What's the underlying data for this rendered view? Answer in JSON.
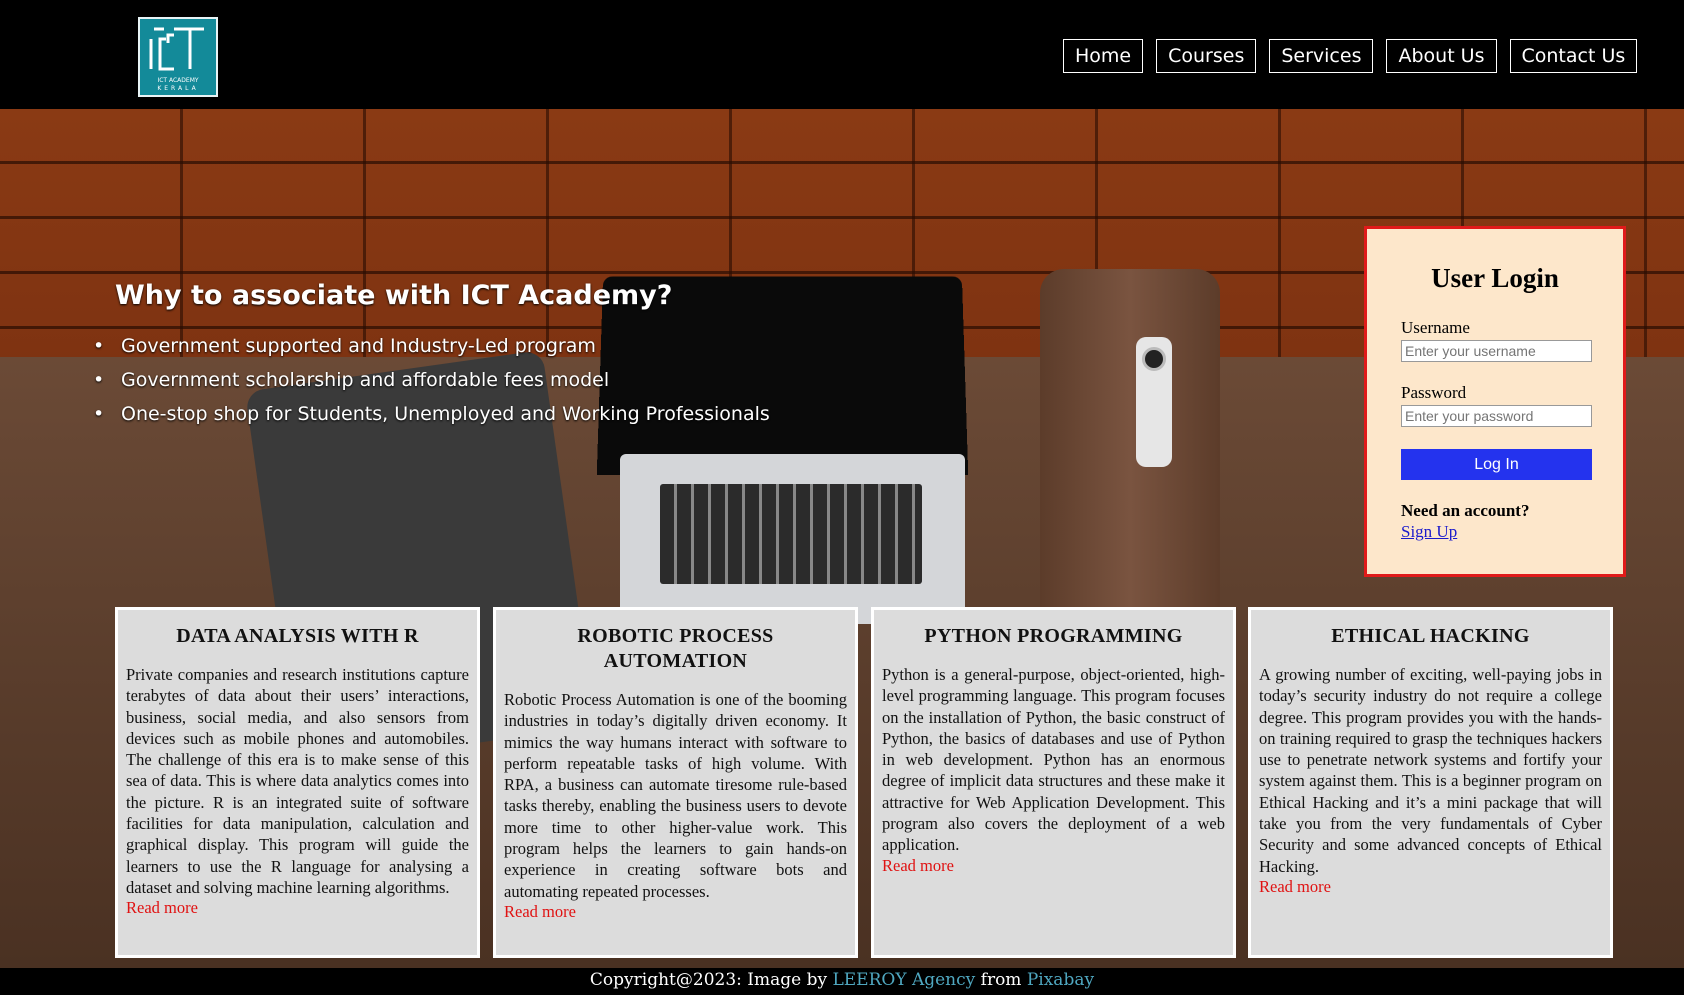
{
  "brand": {
    "logo_text_line1": "ICT ACADEMY",
    "logo_text_line2": "KERALA",
    "logo_color": "#138a99"
  },
  "nav": {
    "items": [
      "Home",
      "Courses",
      "Services",
      "About Us",
      "Contact Us"
    ]
  },
  "intro": {
    "heading": "Why to associate with ICT Academy?",
    "points": [
      "Government supported and Industry-Led program",
      "Government scholarship and affordable fees model",
      "One-stop shop for Students, Unemployed and Working Professionals"
    ]
  },
  "login": {
    "title": "User Login",
    "username_label": "Username",
    "username_placeholder": "Enter your username",
    "password_label": "Password",
    "password_placeholder": "Enter your password",
    "button_label": "Log In",
    "need_account": "Need an account?",
    "signup_label": "Sign Up",
    "border_color": "#e01a1a",
    "button_color": "#2433ee"
  },
  "courses": [
    {
      "title": "DATA ANALYSIS WITH R",
      "body": "Private companies and research institutions capture terabytes of data about their users’ interactions, business, social media, and also sensors from devices such as mobile phones and automobiles. The challenge of this era is to make sense of this sea of data. This is where data analytics comes into the picture. R is an integrated suite of software facilities for data manipulation, calculation and graphical display. This program will guide the learners to use the R language for analysing a dataset and solving machine learning algorithms.",
      "link": "Read more"
    },
    {
      "title": "ROBOTIC PROCESS AUTOMATION",
      "body": "Robotic Process Automation is one of the booming industries in today’s digitally driven economy. It mimics the way humans interact with software to perform repeatable tasks of high volume. With RPA, a business can automate tiresome rule-based tasks thereby, enabling the business users to devote more time to other higher-value work. This program helps the learners to gain hands-on experience in creating software bots and automating repeated processes.",
      "link": "Read more"
    },
    {
      "title": "PYTHON PROGRAMMING",
      "body": "Python is a general-purpose, object-oriented, high-level programming language. This program focuses on the installation of Python, the basic construct of Python, the basics of databases and use of Python in web development. Python has an enormous degree of implicit data structures and these make it attractive for Web Application Development. This program also covers the deployment of a web application.",
      "link": "Read more"
    },
    {
      "title": "ETHICAL HACKING",
      "body": "A growing number of exciting, well-paying jobs in today’s security industry do not require a college degree. This program provides you with the hands-on training required to grasp the techniques hackers use to penetrate network systems and fortify your system against them. This is a beginner program on Ethical Hacking and it’s a mini package that will take you from the very fundamentals of Cyber Security and some advanced concepts of Ethical Hacking.",
      "link": "Read more"
    }
  ],
  "footer": {
    "prefix": "Copyright@2023: Image by",
    "credit1": "LEEROY Agency",
    "middle": "from",
    "credit2": "Pixabay"
  }
}
